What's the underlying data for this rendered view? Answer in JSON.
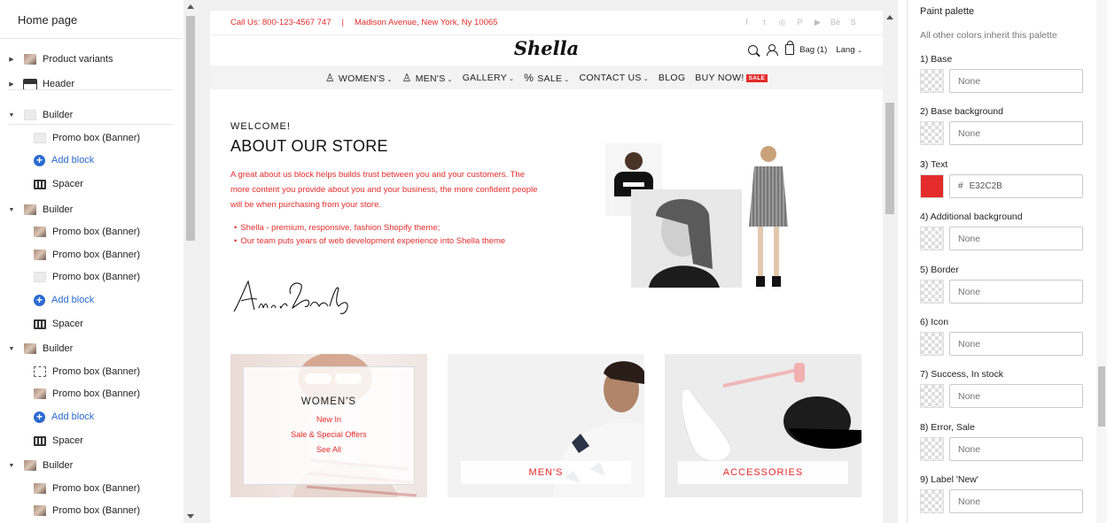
{
  "sidebar": {
    "title": "Home page",
    "add_block_label": "Add block",
    "items": [
      {
        "label": "Product variants",
        "caret": "right",
        "thumb": "img"
      },
      {
        "label": "Header",
        "caret": "right",
        "thumb": "header"
      },
      {
        "label": "Builder",
        "caret": "down",
        "thumb": "gray"
      },
      {
        "label": "Promo box (Banner)",
        "thumb": "gray"
      },
      {
        "label": "Add block",
        "type": "add"
      },
      {
        "label": "Spacer",
        "thumb": "spacer"
      },
      {
        "label": "Builder",
        "caret": "down",
        "thumb": "img"
      },
      {
        "label": "Promo box (Banner)",
        "thumb": "img"
      },
      {
        "label": "Promo box (Banner)",
        "thumb": "img"
      },
      {
        "label": "Promo box (Banner)",
        "thumb": "gray"
      },
      {
        "label": "Add block",
        "type": "add"
      },
      {
        "label": "Spacer",
        "thumb": "spacer"
      },
      {
        "label": "Builder",
        "caret": "down",
        "thumb": "img"
      },
      {
        "label": "Promo box (Banner)",
        "thumb": "dashed"
      },
      {
        "label": "Promo box (Banner)",
        "thumb": "img"
      },
      {
        "label": "Add block",
        "type": "add"
      },
      {
        "label": "Spacer",
        "thumb": "spacer"
      },
      {
        "label": "Builder",
        "caret": "down",
        "thumb": "img"
      },
      {
        "label": "Promo box (Banner)",
        "thumb": "img"
      },
      {
        "label": "Promo box (Banner)",
        "thumb": "img"
      }
    ]
  },
  "store": {
    "topbar": {
      "phone": "Call Us: 800-123-4567 747",
      "separator": "|",
      "address": "Madison Avenue, New York, Ny 10065",
      "social_icons": [
        "f",
        "t",
        "◎",
        "P",
        "▶",
        "Bē",
        "S"
      ]
    },
    "logo": "Shella",
    "header": {
      "bag": "Bag (1)",
      "lang": "Lang"
    },
    "nav": [
      {
        "label": "WOMEN'S",
        "icon": "women-icon",
        "dropdown": true
      },
      {
        "label": "MEN'S",
        "icon": "men-icon",
        "dropdown": true
      },
      {
        "label": "GALLERY",
        "dropdown": true
      },
      {
        "label": "SALE",
        "icon": "percent-icon",
        "dropdown": true
      },
      {
        "label": "CONTACT US",
        "dropdown": true
      },
      {
        "label": "BLOG",
        "dropdown": false
      },
      {
        "label": "BUY NOW!",
        "badge": "SALE",
        "dropdown": false
      }
    ],
    "about": {
      "welcome": "WELCOME!",
      "title": "ABOUT OUR STORE",
      "text": "A great about us block helps builds trust between you and your customers. The more content you provide about you and your business, the more confident people will be when purchasing from your store.",
      "bullets": [
        "Shella - premium, responsive, fashion Shopify theme;",
        "Our team puts years of web development experience into Shella theme"
      ],
      "signature": "Annie Greenberg"
    },
    "categories": {
      "womens": {
        "title": "WOMEN'S",
        "links": [
          "New In",
          "Sale & Special Offers",
          "See All"
        ]
      },
      "mens": {
        "label": "MEN'S"
      },
      "accessories": {
        "label": "ACCESSORIES"
      }
    }
  },
  "palette": {
    "title": "Paint palette",
    "subtitle": "All other colors inherit this palette",
    "rows": [
      {
        "label": "1) Base",
        "value": "",
        "placeholder": "None"
      },
      {
        "label": "2) Base background",
        "value": "",
        "placeholder": "None"
      },
      {
        "label": "3) Text",
        "value": "E32C2B",
        "color": "#e32c2b"
      },
      {
        "label": "4) Additional background",
        "value": "",
        "placeholder": "None"
      },
      {
        "label": "5) Border",
        "value": "",
        "placeholder": "None"
      },
      {
        "label": "6) Icon",
        "value": "",
        "placeholder": "None"
      },
      {
        "label": "7) Success, In stock",
        "value": "",
        "placeholder": "None"
      },
      {
        "label": "8) Error, Sale",
        "value": "",
        "placeholder": "None"
      },
      {
        "label": "9) Label 'New'",
        "value": "",
        "placeholder": "None"
      }
    ]
  },
  "colors": {
    "accent": "#e32c2b",
    "link": "#2b6ad0"
  }
}
